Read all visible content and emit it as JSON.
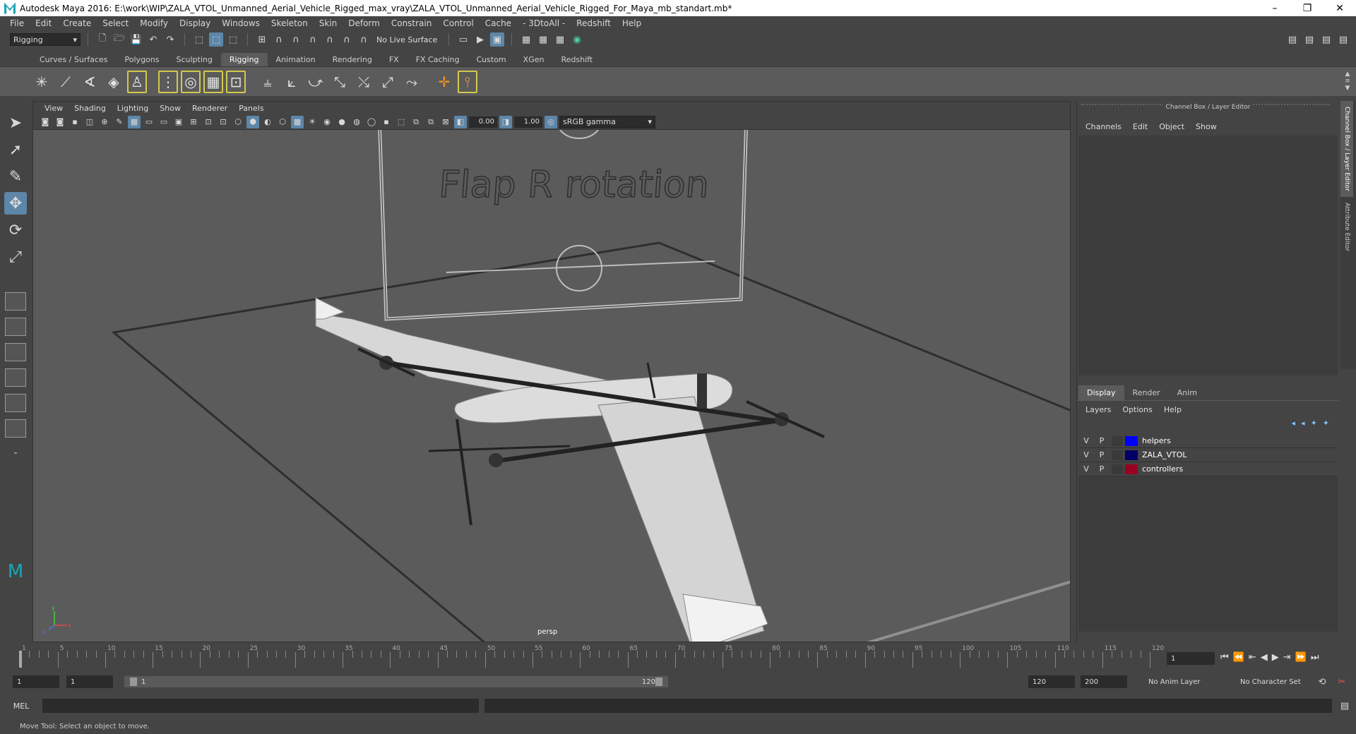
{
  "window": {
    "title": "Autodesk Maya 2016: E:\\work\\WIP\\ZALA_VTOL_Unmanned_Aerial_Vehicle_Rigged_max_vray\\ZALA_VTOL_Unmanned_Aerial_Vehicle_Rigged_For_Maya_mb_standart.mb*",
    "minimize": "–",
    "maximize": "❐",
    "close": "✕"
  },
  "menus": [
    "File",
    "Edit",
    "Create",
    "Select",
    "Modify",
    "Display",
    "Windows",
    "Skeleton",
    "Skin",
    "Deform",
    "Constrain",
    "Control",
    "Cache",
    "- 3DtoAll -",
    "Redshift",
    "Help"
  ],
  "statusline": {
    "mode": "Rigging",
    "live_surface": "No Live Surface"
  },
  "shelf": {
    "tabs": [
      "Curves / Surfaces",
      "Polygons",
      "Sculpting",
      "Rigging",
      "Animation",
      "Rendering",
      "FX",
      "FX Caching",
      "Custom",
      "XGen",
      "Redshift"
    ],
    "active_tab": "Rigging"
  },
  "viewport": {
    "menus": [
      "View",
      "Shading",
      "Lighting",
      "Show",
      "Renderer",
      "Panels"
    ],
    "exposure": "0.00",
    "gamma": "1.00",
    "color_space": "sRGB gamma",
    "camera": "persp",
    "scene_text": "Flap R rotation",
    "axis_x": "x",
    "axis_y": "y",
    "axis_z": "z"
  },
  "channel_box": {
    "title": "Channel Box / Layer Editor",
    "menus": [
      "Channels",
      "Edit",
      "Object",
      "Show"
    ]
  },
  "layer_editor": {
    "tabs": [
      "Display",
      "Render",
      "Anim"
    ],
    "active_tab": "Display",
    "menus": [
      "Layers",
      "Options",
      "Help"
    ],
    "layers": [
      {
        "v": "V",
        "p": "P",
        "name": "helpers",
        "color": "#0000ff"
      },
      {
        "v": "V",
        "p": "P",
        "name": "ZALA_VTOL",
        "color": "#000066"
      },
      {
        "v": "V",
        "p": "P",
        "name": "controllers",
        "color": "#990022"
      }
    ]
  },
  "side_tabs": [
    "Channel Box / Layer Editor",
    "Attribute Editor"
  ],
  "timeslider": {
    "ticks": [
      1,
      5,
      10,
      15,
      20,
      25,
      30,
      35,
      40,
      45,
      50,
      55,
      60,
      65,
      70,
      75,
      80,
      85,
      90,
      95,
      100,
      105,
      110,
      115,
      120
    ],
    "current_frame": "1"
  },
  "range": {
    "start": "1",
    "playback_start": "1",
    "bar_start": "1",
    "bar_end": "120",
    "playback_end": "120",
    "end": "200",
    "anim_layer": "No Anim Layer",
    "character_set": "No Character Set"
  },
  "command_line": {
    "language": "MEL"
  },
  "help_line": "Move Tool: Select an object to move."
}
